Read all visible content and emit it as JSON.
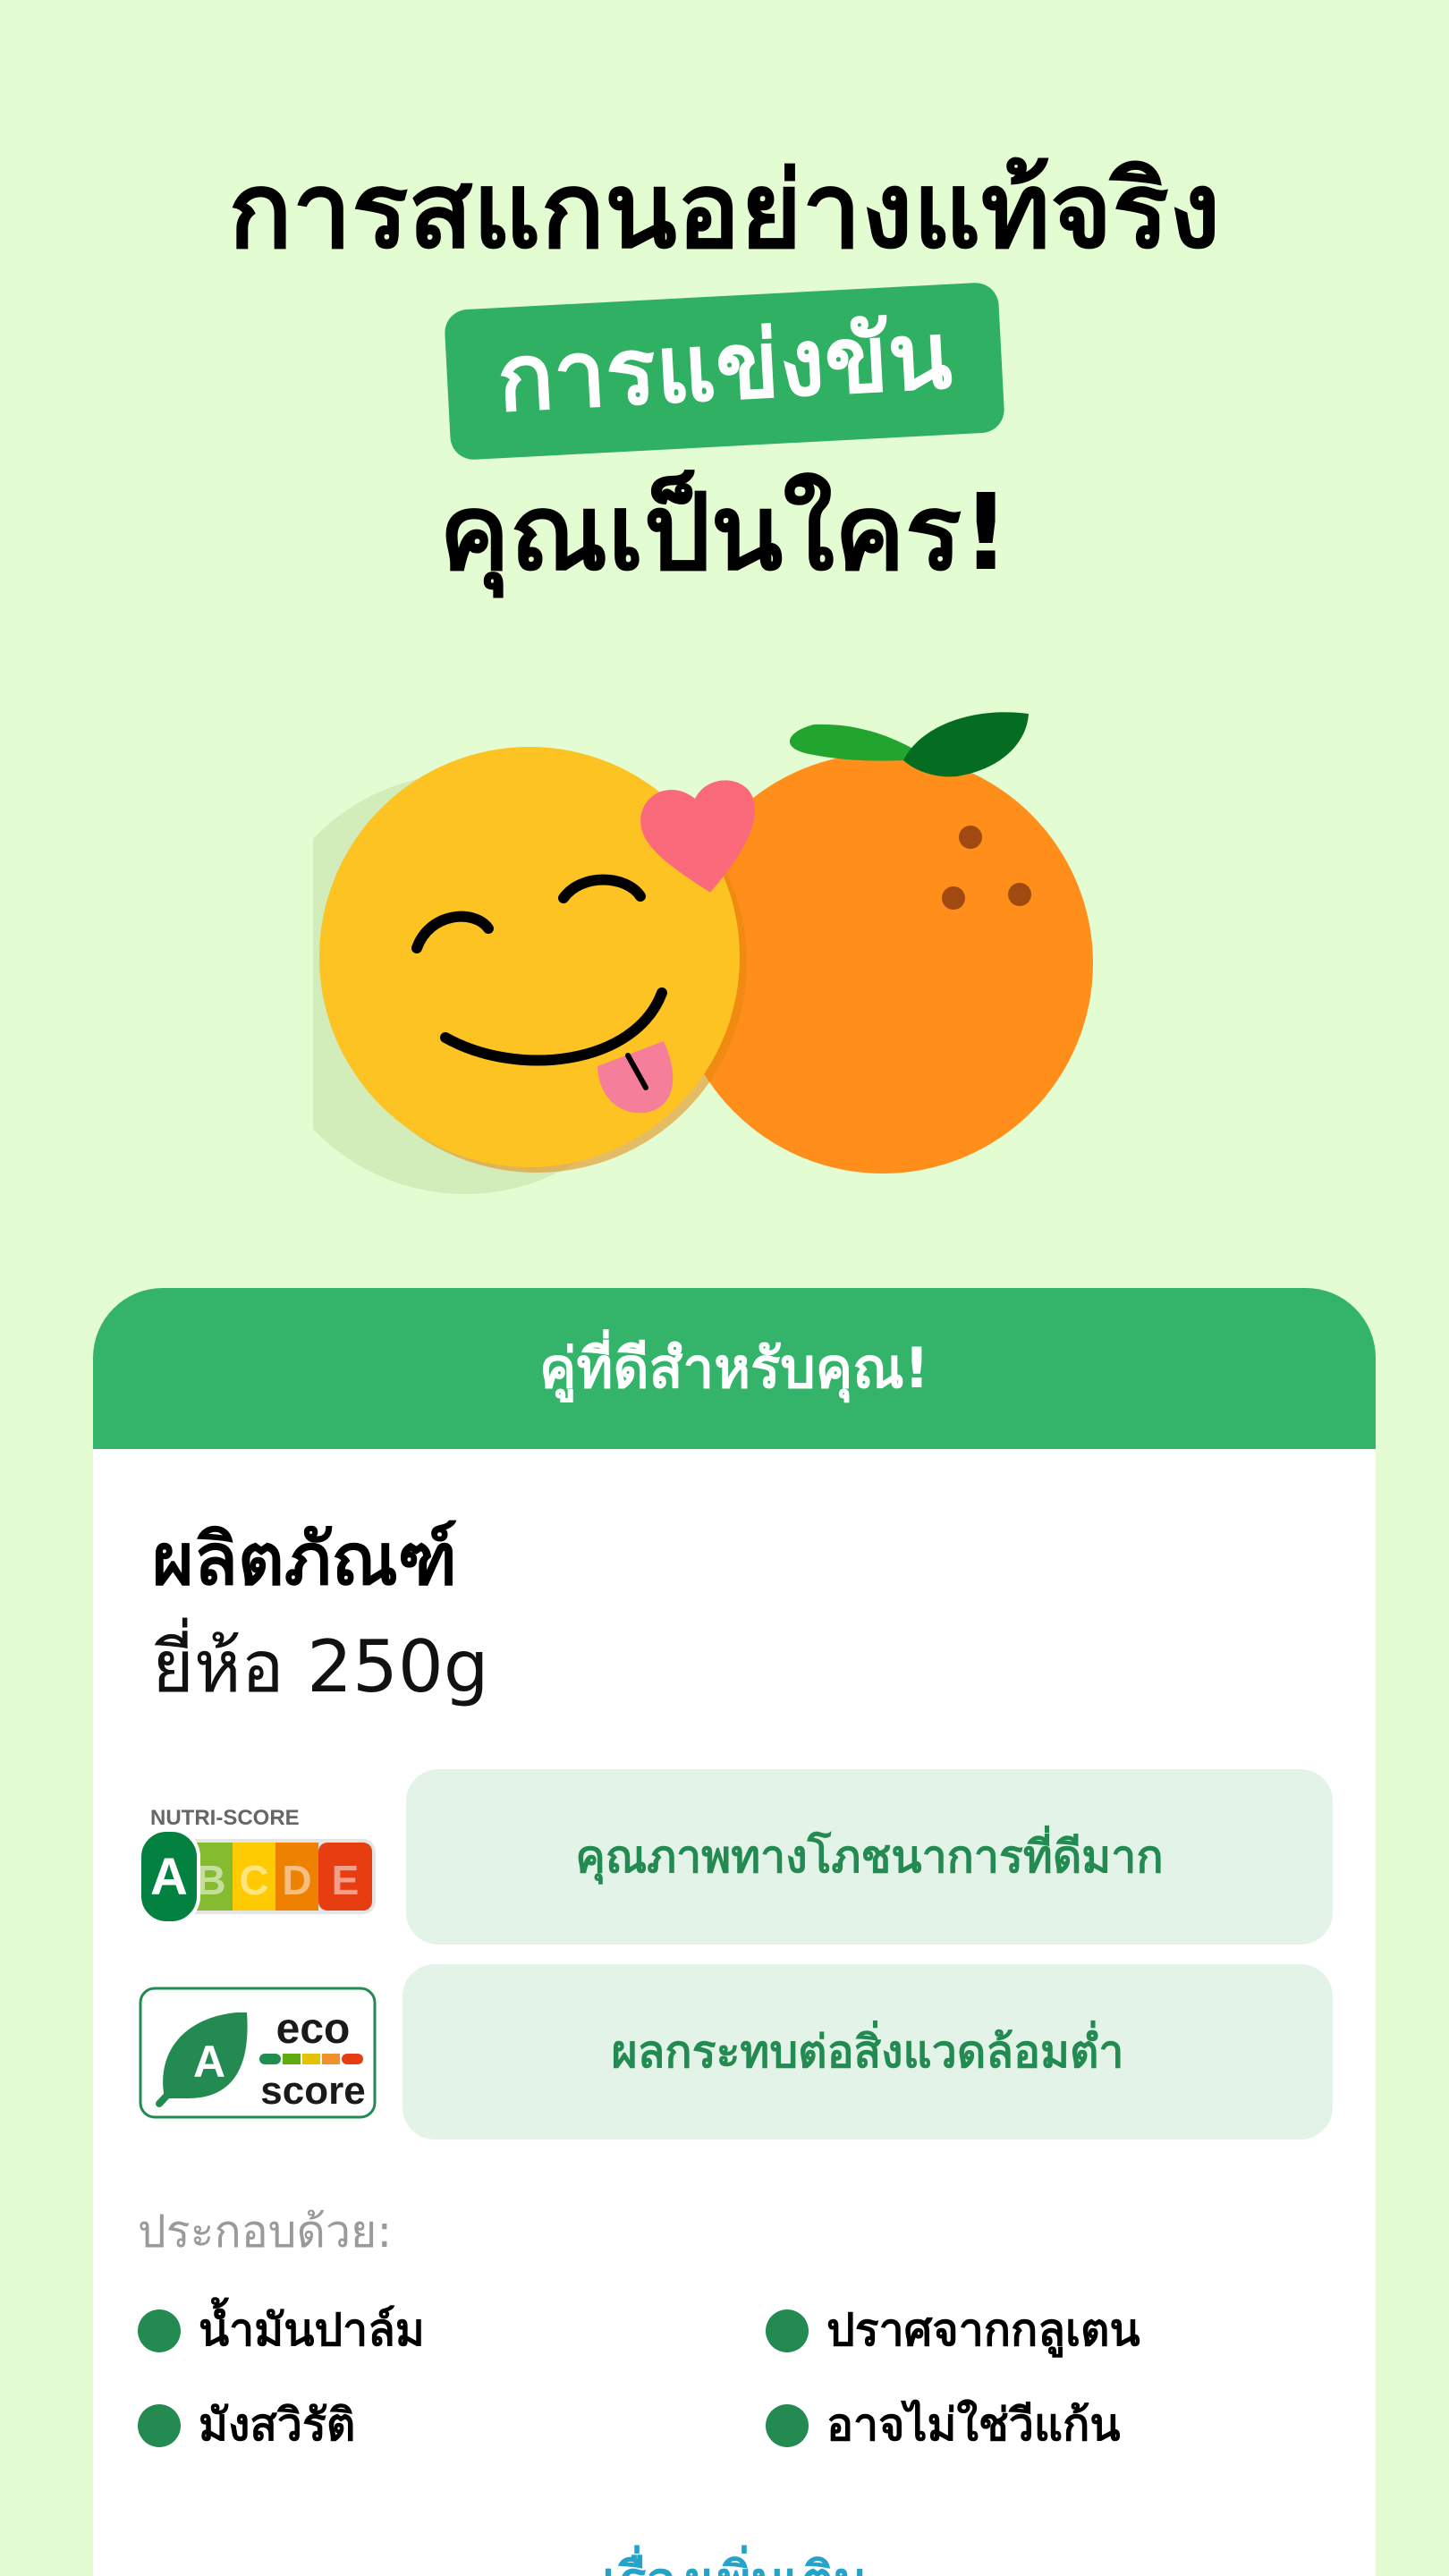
{
  "headline": {
    "line1": "การสแกนอย่างแท้จริง",
    "highlight": "การแข่งขัน",
    "line3": "คุณเป็นใคร!"
  },
  "illustration": {
    "emoji_icon": "yummy-face-icon",
    "heart_icon": "heart-icon",
    "fruit_icon": "orange-icon",
    "colors": {
      "face": "#fdc322",
      "orange": "#ff8e1a",
      "heart": "#fb6a7b",
      "leaf_light": "#22a52e",
      "leaf_dark": "#056d22"
    }
  },
  "card": {
    "header": "คู่ที่ดีสำหรับคุณ!",
    "product_name": "ผลิตภัณฑ์",
    "product_brand": "ยี่ห้อ 250g",
    "nutri_score": {
      "logo_title": "NUTRI-SCORE",
      "letters": [
        "A",
        "B",
        "C",
        "D",
        "E"
      ],
      "grade": "A",
      "description": "คุณภาพทางโภชนาการที่ดีมาก"
    },
    "eco_score": {
      "grade": "A",
      "logo_word_top": "eco",
      "logo_word_bottom": "score",
      "description": "ผลกระทบต่อสิ่งแวดล้อมต่ำ"
    },
    "ingredients_label": "ประกอบด้วย:",
    "ingredients": [
      "น้ำมันปาล์ม",
      "ปราศจากกลูเตน",
      "มังสวิรัติ",
      "อาจไม่ใช่วีแก้น"
    ],
    "more_link": "เรื่องเพิ่มเติม"
  },
  "colors": {
    "background": "#e4fcd1",
    "accent_green": "#33b46a",
    "tag_green": "#238b52",
    "link_blue": "#25a3c9"
  }
}
